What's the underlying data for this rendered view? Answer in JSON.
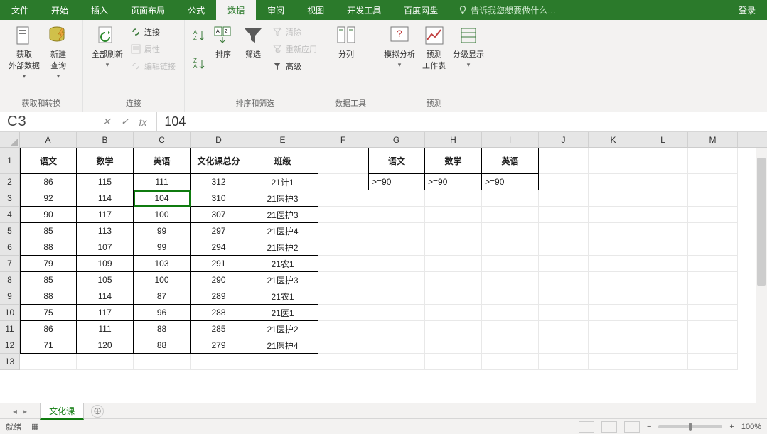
{
  "menu": {
    "items": [
      "文件",
      "开始",
      "插入",
      "页面布局",
      "公式",
      "数据",
      "审阅",
      "视图",
      "开发工具",
      "百度网盘"
    ],
    "active_index": 5,
    "tell_me": "告诉我您想要做什么…",
    "login": "登录"
  },
  "ribbon": {
    "groups": [
      {
        "label": "获取和转换",
        "items": {
          "get_external": "获取\n外部数据",
          "new_query": "新建\n查询"
        }
      },
      {
        "label": "连接",
        "items": {
          "refresh_all": "全部刷新",
          "connections": "连接",
          "properties": "属性",
          "edit_links": "编辑链接"
        }
      },
      {
        "label": "排序和筛选",
        "items": {
          "sort": "排序",
          "filter": "筛选",
          "clear": "清除",
          "reapply": "重新应用",
          "advanced": "高级"
        }
      },
      {
        "label": "数据工具",
        "items": {
          "text_to_cols": "分列"
        }
      },
      {
        "label": "预测",
        "items": {
          "what_if": "模拟分析",
          "forecast": "预测\n工作表",
          "group": "分级显示"
        }
      }
    ]
  },
  "namebox": "C3",
  "formula_value": "104",
  "columns": [
    "A",
    "B",
    "C",
    "D",
    "E",
    "F",
    "G",
    "H",
    "I",
    "J",
    "K",
    "L",
    "M"
  ],
  "headers": [
    "语文",
    "数学",
    "英语",
    "文化课总分",
    "班级"
  ],
  "criteria_headers": [
    "语文",
    "数学",
    "英语"
  ],
  "criteria_values": [
    ">=90",
    ">=90",
    ">=90"
  ],
  "rows": [
    [
      86,
      115,
      111,
      312,
      "21计1"
    ],
    [
      92,
      114,
      104,
      310,
      "21医护3"
    ],
    [
      90,
      117,
      100,
      307,
      "21医护3"
    ],
    [
      85,
      113,
      99,
      297,
      "21医护4"
    ],
    [
      88,
      107,
      99,
      294,
      "21医护2"
    ],
    [
      79,
      109,
      103,
      291,
      "21农1"
    ],
    [
      85,
      105,
      100,
      290,
      "21医护3"
    ],
    [
      88,
      114,
      87,
      289,
      "21农1"
    ],
    [
      75,
      117,
      96,
      288,
      "21医1"
    ],
    [
      86,
      111,
      88,
      285,
      "21医护2"
    ],
    [
      71,
      120,
      88,
      279,
      "21医护4"
    ]
  ],
  "active_cell": {
    "row": 2,
    "col": 2
  },
  "sheet": {
    "tab": "文化课",
    "status": "就绪"
  },
  "zoom": {
    "value": "100%"
  }
}
